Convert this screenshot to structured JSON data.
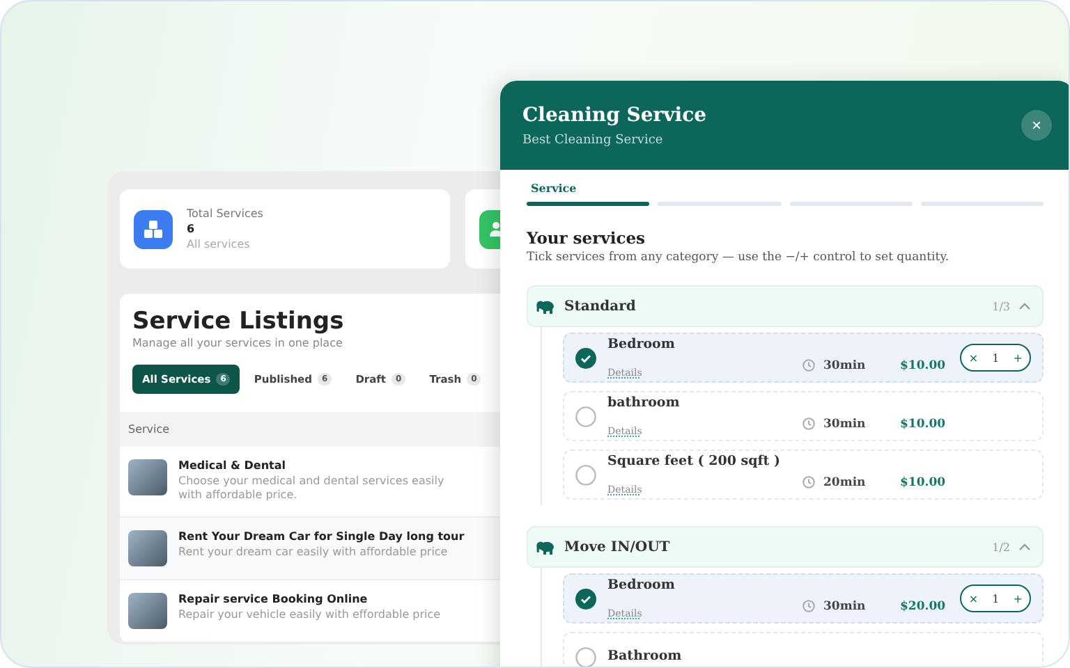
{
  "background_app": {
    "stat_cards": [
      {
        "title": "Total Services",
        "value": "6",
        "note": "All services",
        "color": "#3b7cf0"
      },
      {
        "color": "#34c464"
      }
    ],
    "listing": {
      "title": "Service Listings",
      "subtitle": "Manage all your services in one place",
      "tabs": [
        {
          "label": "All Services",
          "count": "6",
          "selected": true
        },
        {
          "label": "Published",
          "count": "6",
          "selected": false
        },
        {
          "label": "Draft",
          "count": "0",
          "selected": false
        },
        {
          "label": "Trash",
          "count": "0",
          "selected": false
        }
      ],
      "table": {
        "columns": [
          "Service"
        ],
        "rows": [
          {
            "title": "Medical & Dental",
            "description": "Choose your medical and dental services easily with affordable price."
          },
          {
            "title": "Rent Your Dream Car for Single Day long tour",
            "description": "Rent your dream car easily with affordable price"
          },
          {
            "title": "Repair service Booking Online",
            "description": "Repair your vehicle easily with effordable price"
          }
        ]
      }
    }
  },
  "modal": {
    "title": "Cleaning Service",
    "subtitle": "Best Cleaning Service",
    "close": "×",
    "steps": [
      {
        "label": "Service",
        "selected": true
      },
      {
        "selected": false
      },
      {
        "selected": false
      },
      {
        "selected": false
      }
    ],
    "heading": "Your services",
    "instructions": "Tick services from any category — use the −/+ control to set quantity.",
    "categories": [
      {
        "name": "Standard",
        "count": "1/3",
        "expanded": true,
        "items": [
          {
            "name": "Bedroom",
            "link": "Details",
            "duration": "30min",
            "price": "$10.00",
            "checked": true,
            "stepper": {
              "decrement": "×",
              "quantity": "1",
              "increment": "+"
            }
          },
          {
            "name": "bathroom",
            "link": "Details",
            "duration": "30min",
            "price": "$10.00",
            "checked": false
          },
          {
            "name": "Square feet ( 200 sqft )",
            "link": "Details",
            "duration": "20min",
            "price": "$10.00",
            "checked": false
          }
        ]
      },
      {
        "name": "Move IN/OUT",
        "count": "1/2",
        "expanded": true,
        "items": [
          {
            "name": "Bedroom",
            "link": "Details",
            "duration": "30min",
            "price": "$20.00",
            "checked": true,
            "stepper": {
              "decrement": "×",
              "quantity": "1",
              "increment": "+"
            }
          },
          {
            "name": "Bathroom",
            "checked": false
          }
        ]
      }
    ]
  }
}
